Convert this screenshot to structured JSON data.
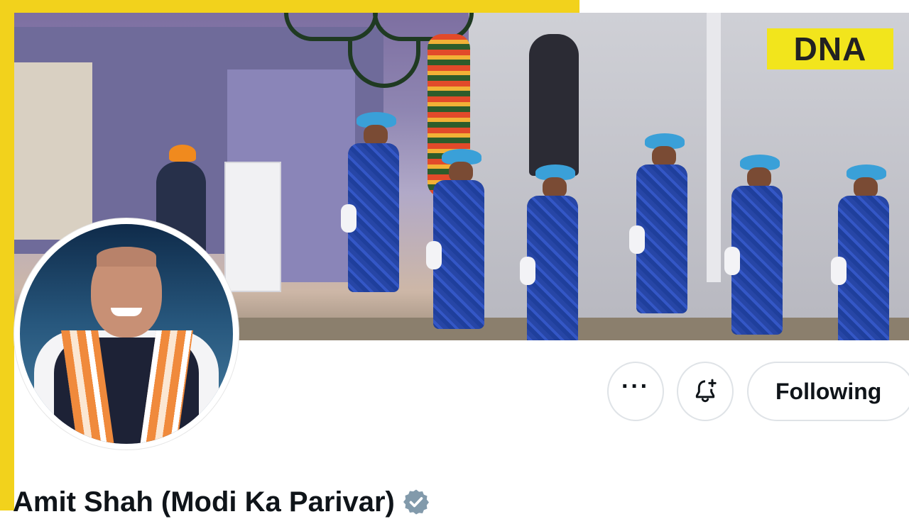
{
  "banner": {
    "logo_text": "DNA"
  },
  "profile": {
    "display_name": "Amit Shah (Modi Ka Parivar)",
    "verified_icon": "verified-badge-icon",
    "verified_color": "#829aab"
  },
  "actions": {
    "more_icon": "more-icon",
    "notify_icon": "bell-plus-icon",
    "following_label": "Following"
  },
  "colors": {
    "frame": "#f2d21c",
    "logo_bg": "#f2e51c",
    "button_border": "#dfe3e7",
    "text": "#0f1419"
  }
}
